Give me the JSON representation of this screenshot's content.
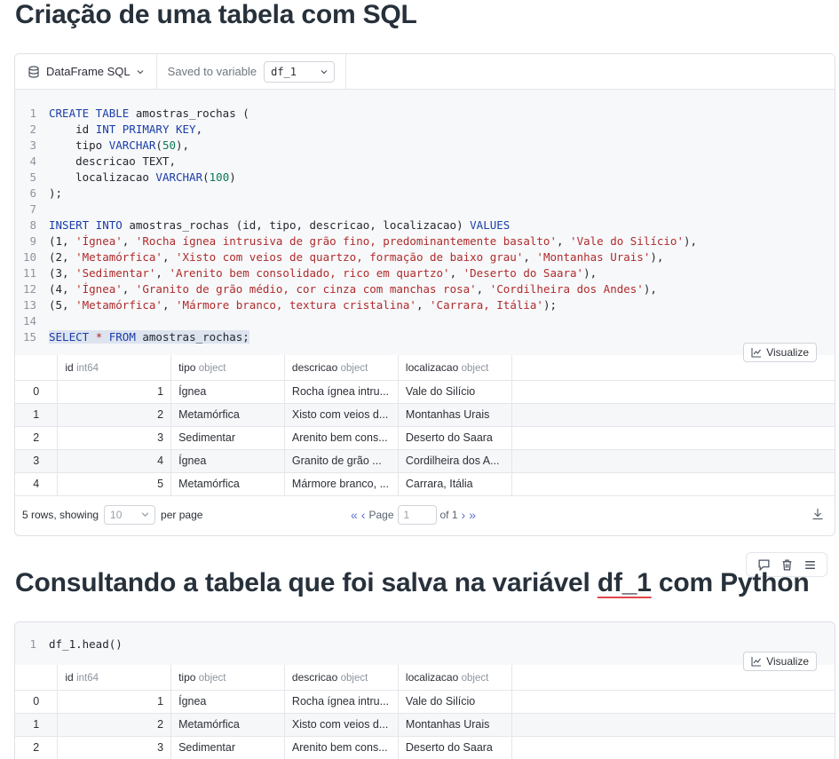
{
  "section1_title": "Criação de uma tabela com SQL",
  "section2_title_prefix": "Consultando a tabela que foi salva na variável ",
  "section2_title_var": "df_1",
  "section2_title_suffix": " com Python",
  "cell1": {
    "source_label": "DataFrame SQL",
    "saved_label": "Saved to variable",
    "variable": "df_1",
    "visualize_label": "Visualize",
    "code_lines": [
      {
        "n": "1",
        "html": "<span class=\"kw\">CREATE TABLE</span> amostras_rochas ("
      },
      {
        "n": "2",
        "html": "    id <span class=\"kw\">INT PRIMARY KEY</span>,"
      },
      {
        "n": "3",
        "html": "    tipo <span class=\"kw\">VARCHAR</span>(<span class=\"num\">50</span>),"
      },
      {
        "n": "4",
        "html": "    descricao TEXT,"
      },
      {
        "n": "5",
        "html": "    localizacao <span class=\"kw\">VARCHAR</span>(<span class=\"num\">100</span>)"
      },
      {
        "n": "6",
        "html": ");"
      },
      {
        "n": "7",
        "html": ""
      },
      {
        "n": "8",
        "html": "<span class=\"kw\">INSERT INTO</span> amostras_rochas (id, tipo, descricao, localizacao) <span class=\"kw\">VALUES</span>"
      },
      {
        "n": "9",
        "html": "(1, <span class=\"str\">'Ígnea'</span>, <span class=\"str\">'Rocha ígnea intrusiva de grão fino, predominantemente basalto'</span>, <span class=\"str\">'Vale do Silício'</span>),"
      },
      {
        "n": "10",
        "html": "(2, <span class=\"str\">'Metamórfica'</span>, <span class=\"str\">'Xisto com veios de quartzo, formação de baixo grau'</span>, <span class=\"str\">'Montanhas Urais'</span>),"
      },
      {
        "n": "11",
        "html": "(3, <span class=\"str\">'Sedimentar'</span>, <span class=\"str\">'Arenito bem consolidado, rico em quartzo'</span>, <span class=\"str\">'Deserto do Saara'</span>),"
      },
      {
        "n": "12",
        "html": "(4, <span class=\"str\">'Ígnea'</span>, <span class=\"str\">'Granito de grão médio, cor cinza com manchas rosa'</span>, <span class=\"str\">'Cordilheira dos Andes'</span>),"
      },
      {
        "n": "13",
        "html": "(5, <span class=\"str\">'Metamórfica'</span>, <span class=\"str\">'Mármore branco, textura cristalina'</span>, <span class=\"str\">'Carrara, Itália'</span>);"
      },
      {
        "n": "14",
        "html": ""
      },
      {
        "n": "15",
        "html": "<span class=\"hl\"><span class=\"kw\">SELECT</span> <span class=\"str\">*</span> <span class=\"kw\">FROM</span> amostras_rochas;</span>"
      }
    ],
    "table": {
      "columns": [
        {
          "name": "id",
          "dtype": "int64"
        },
        {
          "name": "tipo",
          "dtype": "object"
        },
        {
          "name": "descricao",
          "dtype": "object"
        },
        {
          "name": "localizacao",
          "dtype": "object"
        }
      ],
      "rows": [
        [
          "0",
          "1",
          "Ígnea",
          "Rocha ígnea intru...",
          "Vale do Silício"
        ],
        [
          "1",
          "2",
          "Metamórfica",
          "Xisto com veios d...",
          "Montanhas Urais"
        ],
        [
          "2",
          "3",
          "Sedimentar",
          "Arenito bem cons...",
          "Deserto do Saara"
        ],
        [
          "3",
          "4",
          "Ígnea",
          "Granito de grão ...",
          "Cordilheira dos A..."
        ],
        [
          "4",
          "5",
          "Metamórfica",
          "Mármore branco, ...",
          "Carrara, Itália"
        ]
      ]
    },
    "pager": {
      "rows_text": "5 rows, showing",
      "page_size": "10",
      "per_page": "per page",
      "page_label": "Page",
      "page_value": "1",
      "of_text": "of 1"
    }
  },
  "cell2": {
    "code_lines": [
      {
        "n": "1",
        "html": "df_1.head()"
      }
    ],
    "visualize_label": "Visualize",
    "table": {
      "columns": [
        {
          "name": "id",
          "dtype": "int64"
        },
        {
          "name": "tipo",
          "dtype": "object"
        },
        {
          "name": "descricao",
          "dtype": "object"
        },
        {
          "name": "localizacao",
          "dtype": "object"
        }
      ],
      "rows": [
        [
          "0",
          "1",
          "Ígnea",
          "Rocha ígnea intru...",
          "Vale do Silício"
        ],
        [
          "1",
          "2",
          "Metamórfica",
          "Xisto com veios d...",
          "Montanhas Urais"
        ],
        [
          "2",
          "3",
          "Sedimentar",
          "Arenito bem cons...",
          "Deserto do Saara"
        ]
      ]
    }
  },
  "icons": {
    "database": "database-icon",
    "chevron": "chevron-down-icon",
    "chart": "line-chart-icon",
    "download": "download-icon",
    "comment": "comment-icon",
    "trash": "trash-icon",
    "menu": "menu-icon"
  }
}
